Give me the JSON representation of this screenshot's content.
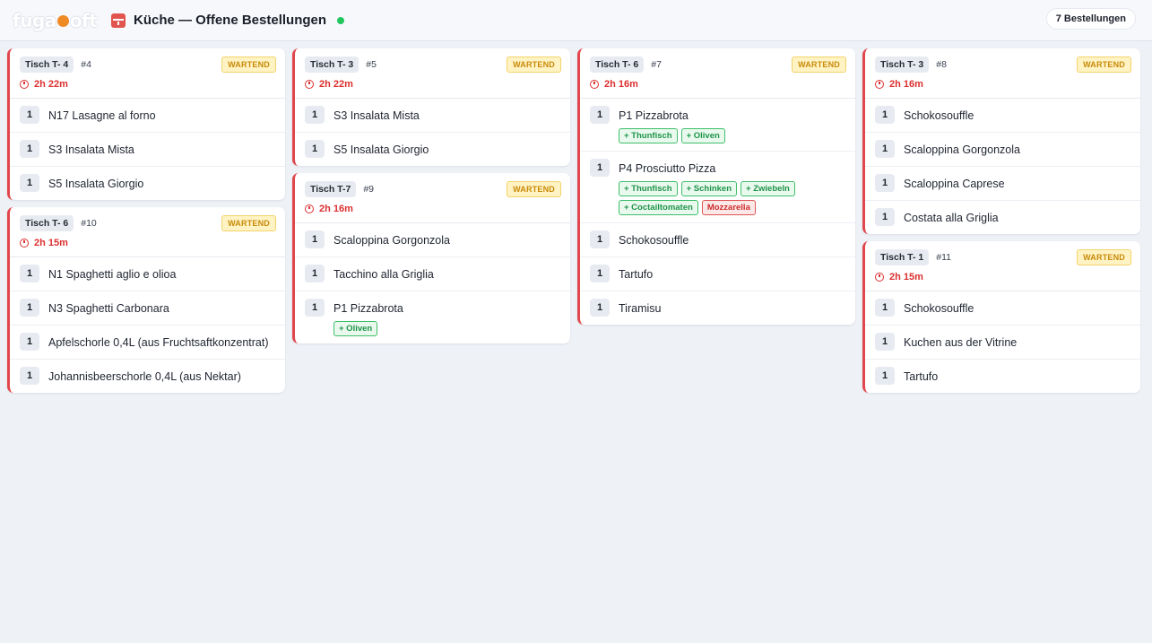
{
  "header": {
    "logo": "fuga soft",
    "title": "Küche — Offene Bestellungen",
    "count": "7 Bestellungen",
    "colors": {
      "accent": "#e0474c",
      "live": "#22c55e",
      "status": "#c88a07"
    }
  },
  "columns": [
    {
      "orders": [
        {
          "table": "Tisch T- 4",
          "number": "#4",
          "status": "WARTEND",
          "elapsed": "2h 22m",
          "items": [
            {
              "qty": "1",
              "name": "N17 Lasagne al forno",
              "mods": []
            },
            {
              "qty": "1",
              "name": "S3 Insalata Mista",
              "mods": []
            },
            {
              "qty": "1",
              "name": "S5 Insalata Giorgio",
              "mods": []
            }
          ]
        },
        {
          "table": "Tisch T- 6",
          "number": "#10",
          "status": "WARTEND",
          "elapsed": "2h 15m",
          "items": [
            {
              "qty": "1",
              "name": "N1 Spaghetti aglio e olioa",
              "mods": []
            },
            {
              "qty": "1",
              "name": "N3 Spaghetti Carbonara",
              "mods": []
            },
            {
              "qty": "1",
              "name": "Apfelschorle 0,4L (aus Fruchtsaftkonzentrat)",
              "mods": []
            },
            {
              "qty": "1",
              "name": "Johannisbeerschorle 0,4L (aus Nektar)",
              "mods": []
            }
          ]
        }
      ]
    },
    {
      "orders": [
        {
          "table": "Tisch T- 3",
          "number": "#5",
          "status": "WARTEND",
          "elapsed": "2h 22m",
          "items": [
            {
              "qty": "1",
              "name": "S3 Insalata Mista",
              "mods": []
            },
            {
              "qty": "1",
              "name": "S5 Insalata Giorgio",
              "mods": []
            }
          ]
        },
        {
          "table": "Tisch T-7",
          "number": "#9",
          "status": "WARTEND",
          "elapsed": "2h 16m",
          "items": [
            {
              "qty": "1",
              "name": "Scaloppina Gorgonzola",
              "mods": []
            },
            {
              "qty": "1",
              "name": "Tacchino alla Griglia",
              "mods": []
            },
            {
              "qty": "1",
              "name": "P1 Pizzabrota",
              "mods": [
                {
                  "label": "+ Oliven",
                  "type": "add"
                }
              ]
            }
          ]
        }
      ]
    },
    {
      "orders": [
        {
          "table": "Tisch T- 6",
          "number": "#7",
          "status": "WARTEND",
          "elapsed": "2h 16m",
          "items": [
            {
              "qty": "1",
              "name": "P1 Pizzabrota",
              "mods": [
                {
                  "label": "+ Thunfisch",
                  "type": "add"
                },
                {
                  "label": "+ Oliven",
                  "type": "add"
                }
              ]
            },
            {
              "qty": "1",
              "name": "P4 Prosciutto Pizza",
              "mods": [
                {
                  "label": "+ Thunfisch",
                  "type": "add"
                },
                {
                  "label": "+ Schinken",
                  "type": "add"
                },
                {
                  "label": "+ Zwiebeln",
                  "type": "add"
                },
                {
                  "label": "+ Coctailtomaten",
                  "type": "add"
                },
                {
                  "label": "Mozzarella",
                  "type": "remove"
                }
              ]
            },
            {
              "qty": "1",
              "name": "Schokosouffle",
              "mods": []
            },
            {
              "qty": "1",
              "name": "Tartufo",
              "mods": []
            },
            {
              "qty": "1",
              "name": "Tiramisu",
              "mods": []
            }
          ]
        }
      ]
    },
    {
      "orders": [
        {
          "table": "Tisch T- 3",
          "number": "#8",
          "status": "WARTEND",
          "elapsed": "2h 16m",
          "items": [
            {
              "qty": "1",
              "name": "Schokosouffle",
              "mods": []
            },
            {
              "qty": "1",
              "name": "Scaloppina Gorgonzola",
              "mods": []
            },
            {
              "qty": "1",
              "name": "Scaloppina Caprese",
              "mods": []
            },
            {
              "qty": "1",
              "name": "Costata alla Griglia",
              "mods": []
            }
          ]
        },
        {
          "table": "Tisch T- 1",
          "number": "#11",
          "status": "WARTEND",
          "elapsed": "2h 15m",
          "items": [
            {
              "qty": "1",
              "name": "Schokosouffle",
              "mods": []
            },
            {
              "qty": "1",
              "name": "Kuchen aus der Vitrine",
              "mods": []
            },
            {
              "qty": "1",
              "name": "Tartufo",
              "mods": []
            }
          ]
        }
      ]
    }
  ]
}
